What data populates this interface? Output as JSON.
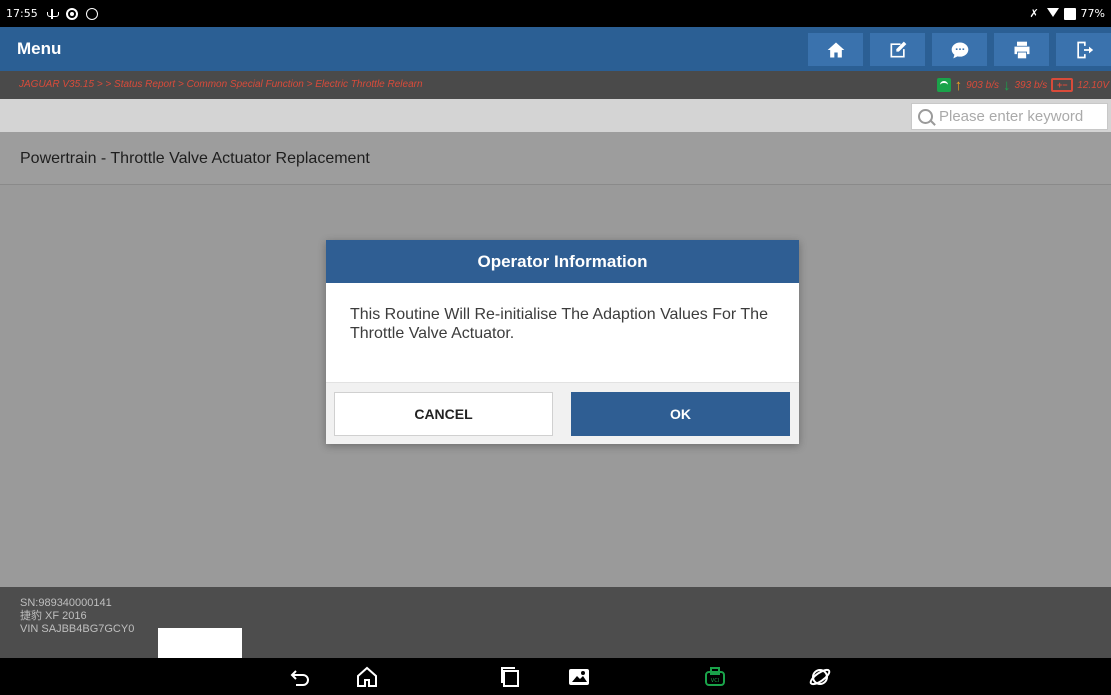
{
  "status_bar": {
    "time": "17:55",
    "battery": "77%",
    "icons": [
      "usb-icon",
      "gear-icon",
      "chat-icon",
      "mute-icon",
      "wifi-icon",
      "battery-icon"
    ]
  },
  "header": {
    "title": "Menu",
    "tools": [
      "home-icon",
      "edit-icon",
      "message-icon",
      "print-icon",
      "exit-icon"
    ]
  },
  "breadcrumb": {
    "text": "JAGUAR V35.15 >  > Status Report > Common Special Function > Electric Throttle Relearn",
    "upload": "903 b/s",
    "download": "393 b/s",
    "voltage": "12.10V"
  },
  "search": {
    "placeholder": "Please enter keyword"
  },
  "content": {
    "item_title": "Powertrain - Throttle Valve Actuator Replacement"
  },
  "dialog": {
    "title": "Operator Information",
    "message": "This Routine Will Re-initialise The Adaption Values For The Throttle Valve Actuator.",
    "cancel_label": "CANCEL",
    "ok_label": "OK"
  },
  "footer": {
    "sn": "SN:989340000141",
    "model": "捷豹 XF 2016",
    "vin": "VIN SAJBB4BG7GCY0"
  },
  "colors": {
    "header": "#2b5f94",
    "dialog_header": "#2f5e93",
    "breadcrumb_text": "#d94b3a",
    "vci_icon": "#1aa34a"
  },
  "navbar": {
    "icons": [
      "back-icon",
      "home-nav-icon",
      "recents-icon",
      "gallery-icon",
      "vci-icon",
      "browser-icon"
    ]
  }
}
